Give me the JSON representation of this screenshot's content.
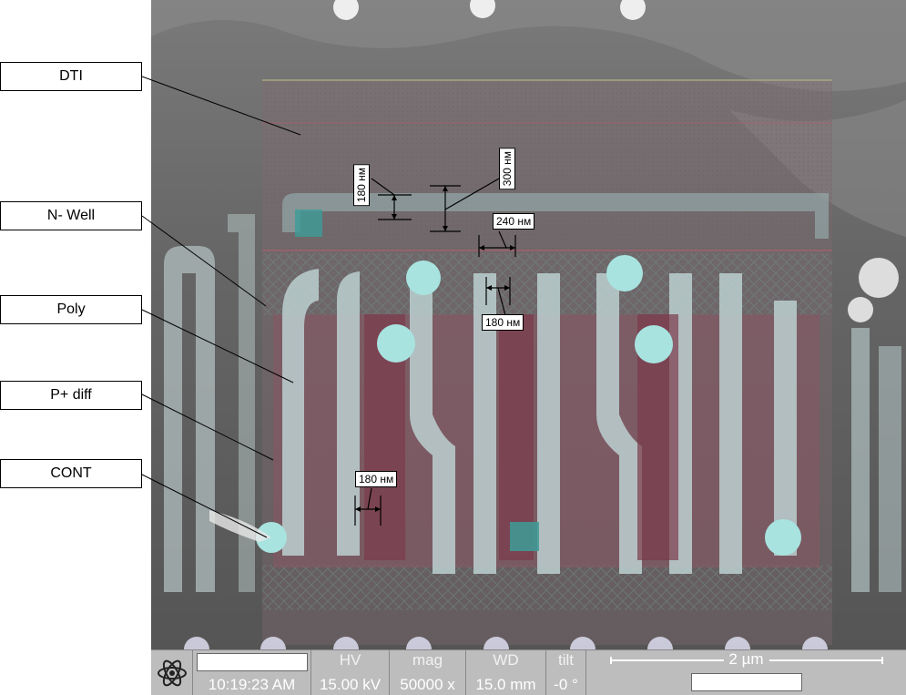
{
  "layer_labels": [
    "DTI",
    "N- Well",
    "Poly",
    "P+ diff",
    "CONT"
  ],
  "measurements": {
    "m180_top": "180 нм",
    "m300": "300 нм",
    "m240": "240 нм",
    "m180_mid": "180 нм",
    "m180_bottom": "180 нм"
  },
  "sem_bar": {
    "time": "10:19:23 AM",
    "hv_label": "HV",
    "hv_value": "15.00 kV",
    "mag_label": "mag",
    "mag_value": "50000 x",
    "wd_label": "WD",
    "wd_value": "15.0 mm",
    "tilt_label": "tilt",
    "tilt_value": "-0 °",
    "scale_text": "2 µm",
    "logo_icon": "atom-icon"
  }
}
